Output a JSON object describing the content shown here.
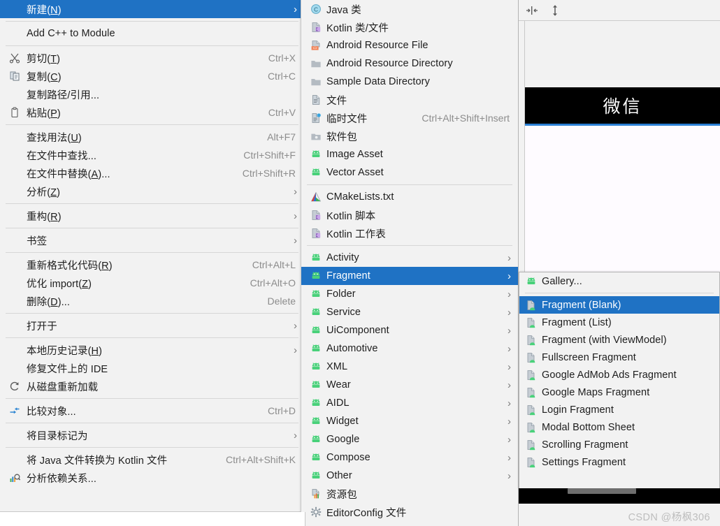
{
  "context_menu": {
    "items": [
      {
        "label": "新建(N)",
        "accel": "",
        "arrow": true,
        "selected": true,
        "icon": "none",
        "underline": "N"
      },
      {
        "sep": true
      },
      {
        "label": "Add C++ to Module",
        "accel": "",
        "arrow": false,
        "icon": "none"
      },
      {
        "sep": true
      },
      {
        "label": "剪切(T)",
        "accel": "Ctrl+X",
        "icon": "scissors-icon",
        "underline": "T"
      },
      {
        "label": "复制(C)",
        "accel": "Ctrl+C",
        "icon": "copy-icon",
        "underline": "C"
      },
      {
        "label": "复制路径/引用...",
        "accel": "",
        "icon": "none"
      },
      {
        "label": "粘贴(P)",
        "accel": "Ctrl+V",
        "icon": "clipboard-icon",
        "underline": "P"
      },
      {
        "sep": true
      },
      {
        "label": "查找用法(U)",
        "accel": "Alt+F7",
        "icon": "none",
        "underline": "U"
      },
      {
        "label": "在文件中查找...",
        "accel": "Ctrl+Shift+F",
        "icon": "none"
      },
      {
        "label": "在文件中替换(A)...",
        "accel": "Ctrl+Shift+R",
        "icon": "none",
        "underline": "A"
      },
      {
        "label": "分析(Z)",
        "accel": "",
        "arrow": true,
        "icon": "none",
        "underline": "Z"
      },
      {
        "sep": true
      },
      {
        "label": "重构(R)",
        "accel": "",
        "arrow": true,
        "icon": "none",
        "underline": "R"
      },
      {
        "sep": true
      },
      {
        "label": "书签",
        "accel": "",
        "arrow": true,
        "icon": "none"
      },
      {
        "sep": true
      },
      {
        "label": "重新格式化代码(R)",
        "accel": "Ctrl+Alt+L",
        "icon": "none",
        "underline": "R"
      },
      {
        "label": "优化 import(Z)",
        "accel": "Ctrl+Alt+O",
        "icon": "none",
        "underline": "Z"
      },
      {
        "label": "删除(D)...",
        "accel": "Delete",
        "icon": "none",
        "underline": "D"
      },
      {
        "sep": true
      },
      {
        "label": "打开于",
        "accel": "",
        "arrow": true,
        "icon": "none"
      },
      {
        "sep": true
      },
      {
        "label": "本地历史记录(H)",
        "accel": "",
        "arrow": true,
        "icon": "none",
        "underline": "H"
      },
      {
        "label": "修复文件上的 IDE",
        "accel": "",
        "icon": "none"
      },
      {
        "label": "从磁盘重新加载",
        "accel": "",
        "icon": "refresh-icon"
      },
      {
        "sep": true
      },
      {
        "label": "比较对象...",
        "accel": "Ctrl+D",
        "icon": "compare-icon"
      },
      {
        "sep": true
      },
      {
        "label": "将目录标记为",
        "accel": "",
        "arrow": true,
        "icon": "none"
      },
      {
        "sep": true
      },
      {
        "label": "将 Java 文件转换为 Kotlin 文件",
        "accel": "Ctrl+Alt+Shift+K",
        "icon": "none"
      },
      {
        "label": "分析依赖关系...",
        "accel": "",
        "icon": "analyze-icon"
      }
    ]
  },
  "new_submenu": {
    "items": [
      {
        "label": "Java 类",
        "icon": "java-class-icon"
      },
      {
        "label": "Kotlin 类/文件",
        "icon": "kotlin-file-icon"
      },
      {
        "label": "Android Resource File",
        "icon": "android-resource-file-icon"
      },
      {
        "label": "Android Resource Directory",
        "icon": "folder-icon"
      },
      {
        "label": "Sample Data Directory",
        "icon": "folder-icon"
      },
      {
        "label": "文件",
        "icon": "file-icon"
      },
      {
        "label": "临时文件",
        "accel": "Ctrl+Alt+Shift+Insert",
        "icon": "scratch-file-icon"
      },
      {
        "label": "软件包",
        "icon": "package-icon"
      },
      {
        "label": "Image Asset",
        "icon": "android-icon"
      },
      {
        "label": "Vector Asset",
        "icon": "android-icon"
      },
      {
        "sep": true
      },
      {
        "label": "CMakeLists.txt",
        "icon": "cmake-icon"
      },
      {
        "label": "Kotlin 脚本",
        "icon": "kotlin-file-icon"
      },
      {
        "label": "Kotlin 工作表",
        "icon": "kotlin-file-icon"
      },
      {
        "sep": true
      },
      {
        "label": "Activity",
        "arrow": true,
        "icon": "android-icon"
      },
      {
        "label": "Fragment",
        "arrow": true,
        "icon": "android-icon",
        "selected": true
      },
      {
        "label": "Folder",
        "arrow": true,
        "icon": "android-icon"
      },
      {
        "label": "Service",
        "arrow": true,
        "icon": "android-icon"
      },
      {
        "label": "UiComponent",
        "arrow": true,
        "icon": "android-icon"
      },
      {
        "label": "Automotive",
        "arrow": true,
        "icon": "android-icon"
      },
      {
        "label": "XML",
        "arrow": true,
        "icon": "android-icon"
      },
      {
        "label": "Wear",
        "arrow": true,
        "icon": "android-icon"
      },
      {
        "label": "AIDL",
        "arrow": true,
        "icon": "android-icon"
      },
      {
        "label": "Widget",
        "arrow": true,
        "icon": "android-icon"
      },
      {
        "label": "Google",
        "arrow": true,
        "icon": "android-icon"
      },
      {
        "label": "Compose",
        "arrow": true,
        "icon": "android-icon"
      },
      {
        "label": "Other",
        "arrow": true,
        "icon": "android-icon"
      },
      {
        "label": "资源包",
        "icon": "resource-bundle-icon"
      },
      {
        "label": "EditorConfig 文件",
        "icon": "gear-icon"
      }
    ]
  },
  "fragment_submenu": {
    "items": [
      {
        "label": "Gallery...",
        "icon": "android-icon"
      },
      {
        "sep": true
      },
      {
        "label": "Fragment (Blank)",
        "icon": "fragment-template-icon",
        "selected": true
      },
      {
        "label": "Fragment (List)",
        "icon": "fragment-template-icon"
      },
      {
        "label": "Fragment (with ViewModel)",
        "icon": "fragment-template-icon"
      },
      {
        "label": "Fullscreen Fragment",
        "icon": "fragment-template-icon"
      },
      {
        "label": "Google AdMob Ads Fragment",
        "icon": "fragment-template-icon"
      },
      {
        "label": "Google Maps Fragment",
        "icon": "fragment-template-icon"
      },
      {
        "label": "Login Fragment",
        "icon": "fragment-template-icon"
      },
      {
        "label": "Modal Bottom Sheet",
        "icon": "fragment-template-icon"
      },
      {
        "label": "Scrolling Fragment",
        "icon": "fragment-template-icon"
      },
      {
        "label": "Settings Fragment",
        "icon": "fragment-template-icon"
      }
    ]
  },
  "preview": {
    "toolbar": [
      {
        "icon": "fit-horizontal-icon"
      },
      {
        "icon": "fit-vertical-icon"
      }
    ],
    "app_bar_title": "微信",
    "app_bar_bg": "#000000",
    "app_bar_accent": "#2a7fd4"
  },
  "footer": {
    "watermark": "CSDN @杨枫306"
  },
  "colors": {
    "selection": "#1f72c4",
    "menu_bg": "#f2f2f2",
    "accel_text": "#8c8c8c"
  }
}
